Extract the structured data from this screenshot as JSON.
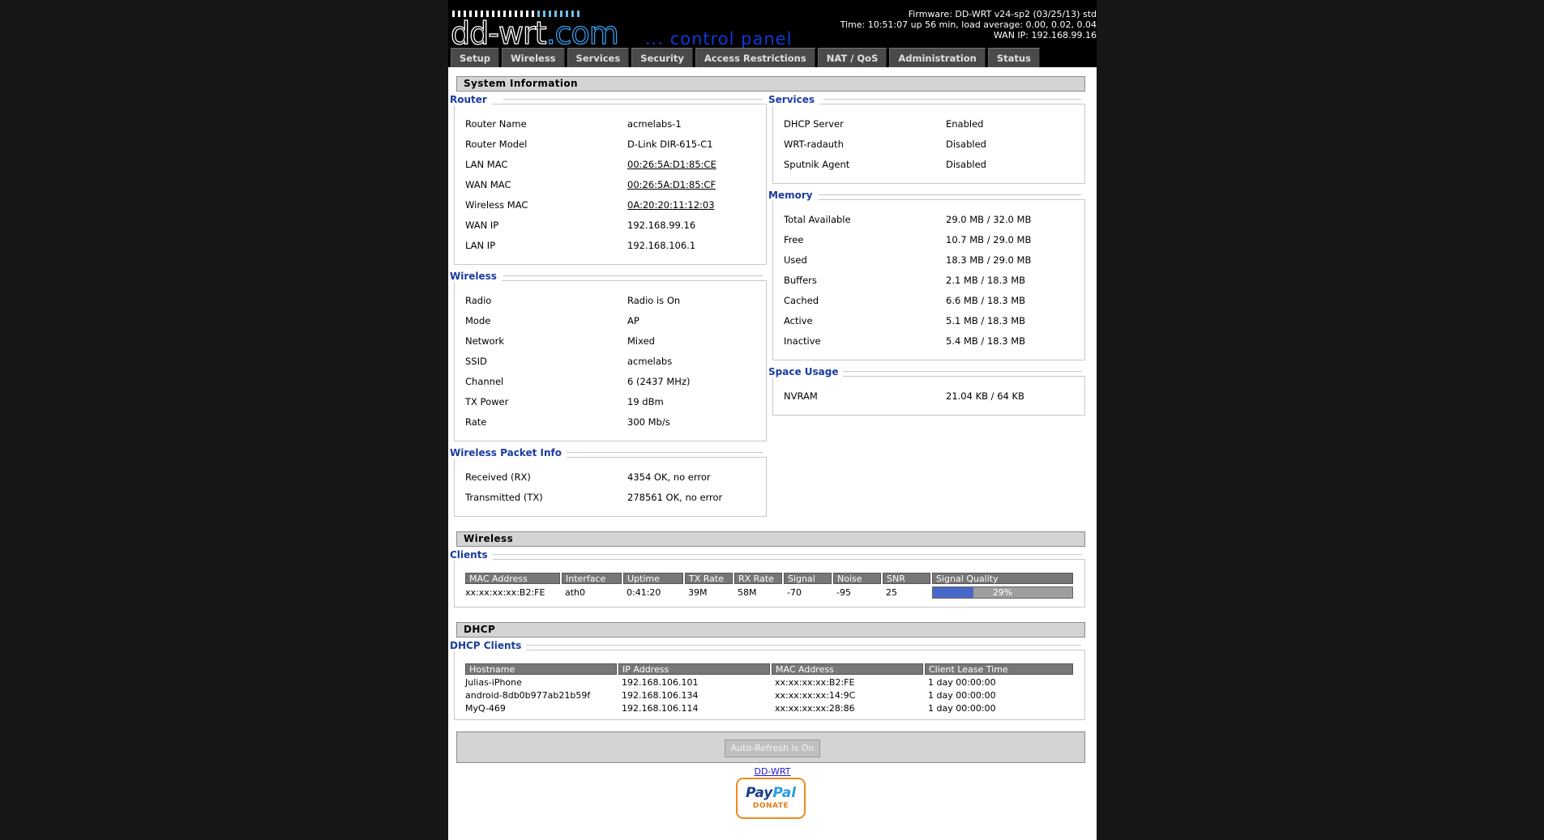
{
  "logo": {
    "name": "dd-wrt",
    "domain": ".com",
    "tagline": "... control panel"
  },
  "header": {
    "firmware": "Firmware: DD-WRT v24-sp2 (03/25/13) std",
    "time": "Time: 10:51:07 up 56 min, load average: 0.00, 0.02, 0.04",
    "wan_ip": "WAN IP: 192.168.99.16"
  },
  "tabs": [
    "Setup",
    "Wireless",
    "Services",
    "Security",
    "Access Restrictions",
    "NAT / QoS",
    "Administration",
    "Status"
  ],
  "system_info": {
    "title": "System Information",
    "router": {
      "legend": "Router",
      "rows": [
        {
          "label": "Router Name",
          "value": "acmelabs-1"
        },
        {
          "label": "Router Model",
          "value": "D-Link DIR-615-C1"
        },
        {
          "label": "LAN MAC",
          "value": "00:26:5A:D1:85:CE"
        },
        {
          "label": "WAN MAC",
          "value": "00:26:5A:D1:85:CF"
        },
        {
          "label": "Wireless MAC",
          "value": "0A:20:20:11:12:03"
        },
        {
          "label": "WAN IP",
          "value": "192.168.99.16"
        },
        {
          "label": "LAN IP",
          "value": "192.168.106.1"
        }
      ]
    },
    "wireless": {
      "legend": "Wireless",
      "rows": [
        {
          "label": "Radio",
          "value": "Radio is On"
        },
        {
          "label": "Mode",
          "value": "AP"
        },
        {
          "label": "Network",
          "value": "Mixed"
        },
        {
          "label": "SSID",
          "value": "acmelabs"
        },
        {
          "label": "Channel",
          "value": "6 (2437 MHz)"
        },
        {
          "label": "TX Power",
          "value": "19 dBm"
        },
        {
          "label": "Rate",
          "value": "300 Mb/s"
        }
      ]
    },
    "packet_info": {
      "legend": "Wireless Packet Info",
      "rows": [
        {
          "label": "Received (RX)",
          "value": "4354 OK, no error"
        },
        {
          "label": "Transmitted (TX)",
          "value": "278561 OK, no error"
        }
      ]
    },
    "services": {
      "legend": "Services",
      "rows": [
        {
          "label": "DHCP Server",
          "value": "Enabled"
        },
        {
          "label": "WRT-radauth",
          "value": "Disabled"
        },
        {
          "label": "Sputnik Agent",
          "value": "Disabled"
        }
      ]
    },
    "memory": {
      "legend": "Memory",
      "rows": [
        {
          "label": "Total Available",
          "value": "29.0 MB / 32.0 MB"
        },
        {
          "label": "Free",
          "value": "10.7 MB / 29.0 MB"
        },
        {
          "label": "Used",
          "value": "18.3 MB / 29.0 MB"
        },
        {
          "label": "Buffers",
          "value": "2.1 MB / 18.3 MB"
        },
        {
          "label": "Cached",
          "value": "6.6 MB / 18.3 MB"
        },
        {
          "label": "Active",
          "value": "5.1 MB / 18.3 MB"
        },
        {
          "label": "Inactive",
          "value": "5.4 MB / 18.3 MB"
        }
      ]
    },
    "space": {
      "legend": "Space Usage",
      "rows": [
        {
          "label": "NVRAM",
          "value": "21.04 KB / 64 KB"
        }
      ]
    }
  },
  "wireless_section": {
    "title": "Wireless",
    "clients_legend": "Clients",
    "columns": [
      "MAC Address",
      "Interface",
      "Uptime",
      "TX Rate",
      "RX Rate",
      "Signal",
      "Noise",
      "SNR",
      "Signal Quality"
    ],
    "rows": [
      {
        "mac": "xx:xx:xx:xx:B2:FE",
        "interface": "ath0",
        "uptime": "0:41:20",
        "tx": "39M",
        "rx": "58M",
        "signal": "-70",
        "noise": "-95",
        "snr": "25",
        "quality_text": "29%",
        "quality": 0.29
      }
    ]
  },
  "dhcp_section": {
    "title": "DHCP",
    "clients_legend": "DHCP Clients",
    "columns": [
      "Hostname",
      "IP Address",
      "MAC Address",
      "Client Lease Time"
    ],
    "rows": [
      {
        "host": "Julias-iPhone",
        "ip": "192.168.106.101",
        "mac": "xx:xx:xx:xx:B2:FE",
        "lease": "1 day 00:00:00"
      },
      {
        "host": "android-8db0b977ab21b59f",
        "ip": "192.168.106.134",
        "mac": "xx:xx:xx:xx:14:9C",
        "lease": "1 day 00:00:00"
      },
      {
        "host": "MyQ-469",
        "ip": "192.168.106.114",
        "mac": "xx:xx:xx:xx:28:86",
        "lease": "1 day 00:00:00"
      }
    ]
  },
  "footer": {
    "refresh_label": "Auto-Refresh is On",
    "link": "DD-WRT",
    "paypal_a": "Pay",
    "paypal_b": "Pal",
    "donate": "DONATE"
  },
  "colors": {
    "legend": "#1a3ca0",
    "signal_fill": "#4869c8",
    "paypal_border": "#f08a1d"
  }
}
